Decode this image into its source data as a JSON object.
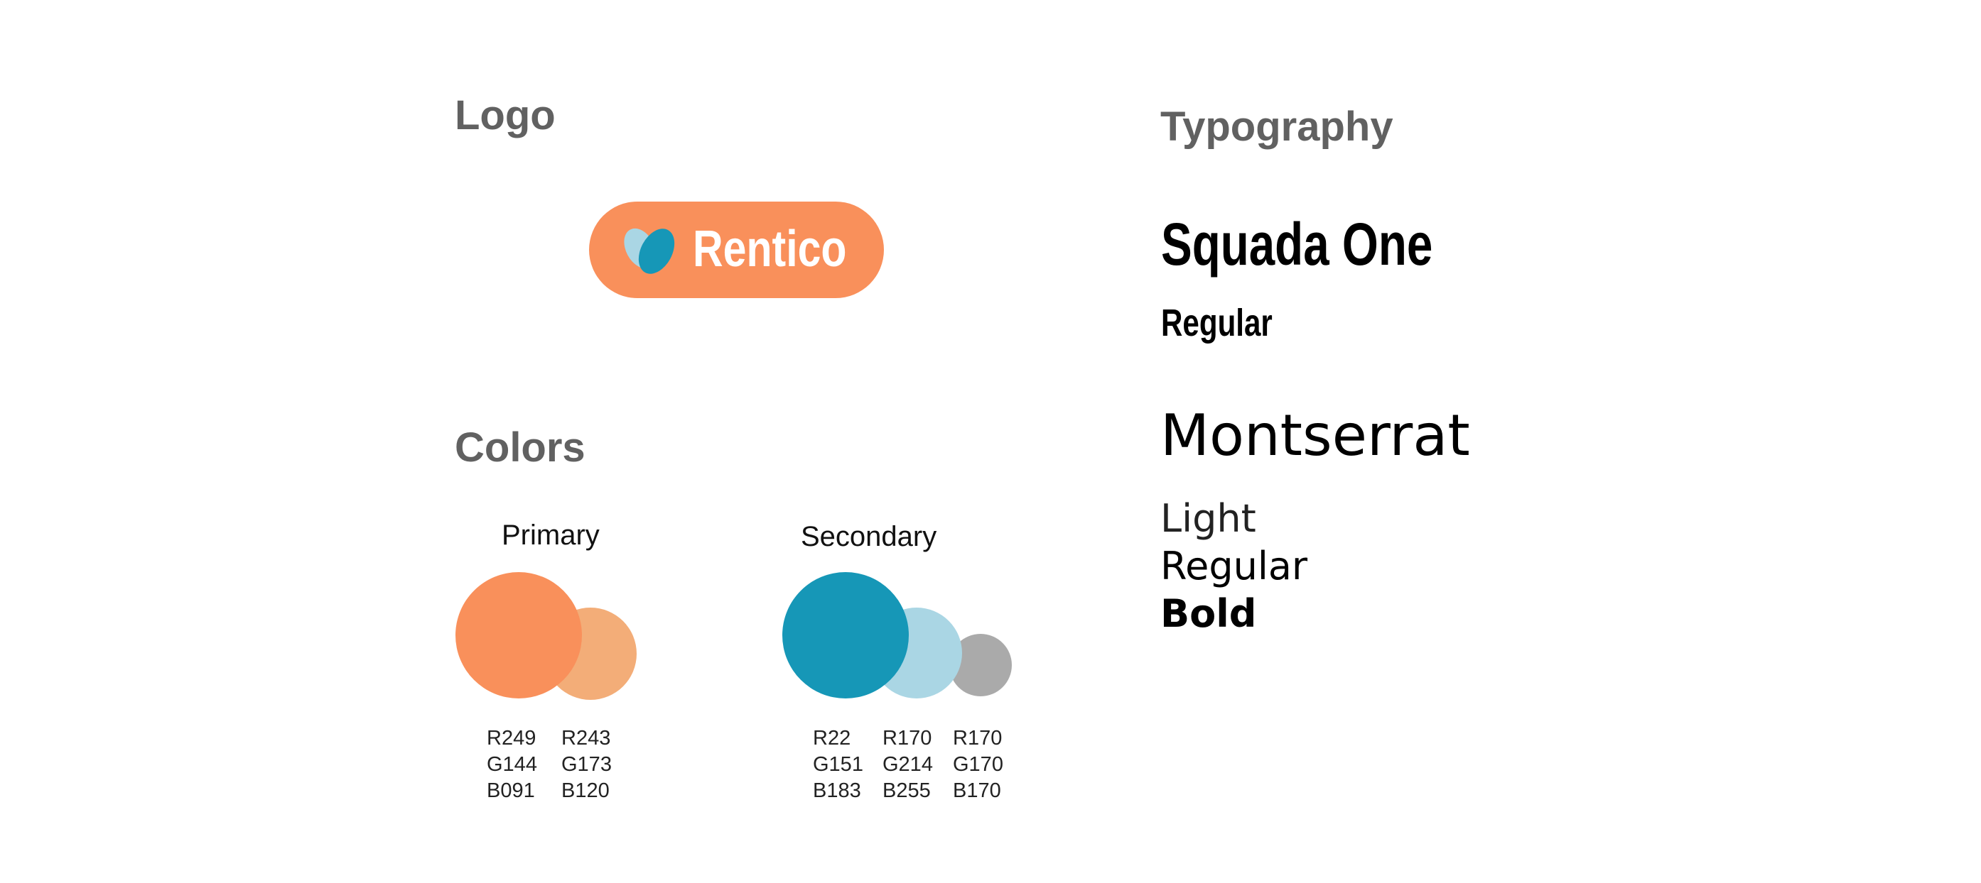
{
  "logo": {
    "heading": "Logo",
    "wordmark": "Rentico"
  },
  "colors": {
    "heading": "Colors",
    "primary": {
      "label": "Primary",
      "swatches": [
        {
          "hex": "#f9905b",
          "r": "R249",
          "g": "G144",
          "b": "B091"
        },
        {
          "hex": "#f3ad78",
          "r": "R243",
          "g": "G173",
          "b": "B120"
        }
      ]
    },
    "secondary": {
      "label": "Secondary",
      "swatches": [
        {
          "hex": "#1697b7",
          "r": "R22",
          "g": "G151",
          "b": "B183"
        },
        {
          "hex": "#aad6e4",
          "r": "R170",
          "g": "G214",
          "b": "B255"
        },
        {
          "hex": "#aaaaaa",
          "r": "R170",
          "g": "G170",
          "b": "B170"
        }
      ]
    }
  },
  "typography": {
    "heading": "Typography",
    "display_font": {
      "name": "Squada One",
      "weights": [
        "Regular"
      ]
    },
    "body_font": {
      "name": "Montserrat",
      "weights": [
        "Light",
        "Regular",
        "Bold"
      ]
    }
  },
  "accent_colors": {
    "heading_gray": "#616161",
    "logo_orange": "#f9905b",
    "logo_mark_dark": "#1697b7",
    "logo_mark_light": "#aad6e4"
  }
}
